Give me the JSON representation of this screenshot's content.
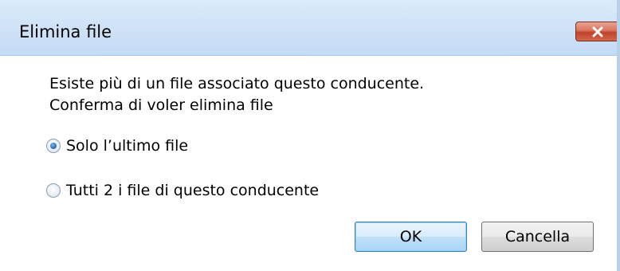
{
  "window": {
    "title": "Elimina file",
    "close_label": "close"
  },
  "message": {
    "line1": "Esiste più di un file associato questo conducente.",
    "line2": "Conferma di voler elimina file"
  },
  "options": [
    {
      "label": "Solo l’ultimo file",
      "selected": true
    },
    {
      "label": "Tutti 2 i file di questo conducente",
      "selected": false
    }
  ],
  "buttons": {
    "ok_label": "OK",
    "cancel_label": "Cancella"
  },
  "colors": {
    "titlebar": "#cfe2f7",
    "close_button": "#c9553c",
    "ok_border": "#3c7fb1",
    "radio_dot": "#2a6fc1"
  }
}
